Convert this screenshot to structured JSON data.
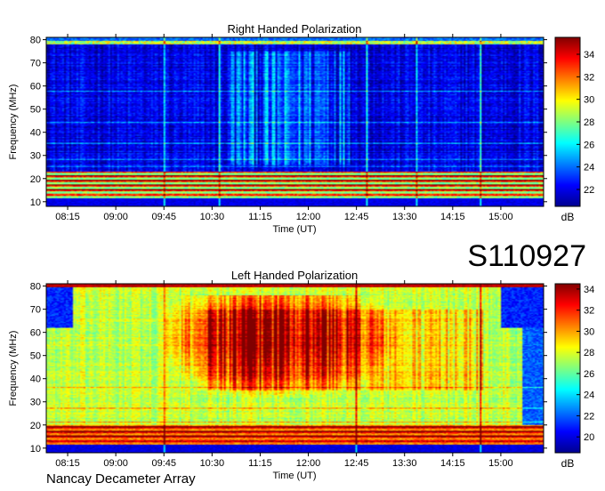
{
  "chart_data": [
    {
      "type": "heatmap",
      "title": "Right Handed Polarization",
      "xlabel": "Time (UT)",
      "ylabel": "Frequency (MHz)",
      "x_ticks": [
        "08:15",
        "09:00",
        "09:45",
        "10:30",
        "11:15",
        "12:00",
        "12:45",
        "13:30",
        "14:15",
        "15:00"
      ],
      "x_range": [
        "07:55",
        "15:40"
      ],
      "y_ticks": [
        10,
        20,
        30,
        40,
        50,
        60,
        70,
        80
      ],
      "ylim": [
        8,
        81
      ],
      "colorbar": {
        "label": "dB",
        "ticks": [
          22,
          24,
          26,
          28,
          30,
          32,
          34
        ],
        "range": [
          20.5,
          35.5
        ]
      },
      "colormap": "jet",
      "features": {
        "background_db": 22,
        "low_freq_band_mhz": [
          10,
          23
        ],
        "low_freq_band_db": 33,
        "top_band_mhz": 79,
        "top_band_db": 29,
        "horizontal_lines_mhz": [
          15,
          17,
          19,
          21,
          25,
          28,
          35,
          44,
          58
        ],
        "vertical_lines": [
          "09:45",
          "10:37",
          "12:55",
          "13:42",
          "14:42"
        ],
        "enhanced_interval": [
          "10:45",
          "12:45"
        ],
        "enhanced_db": 25
      }
    },
    {
      "type": "heatmap",
      "title": "Left Handed Polarization",
      "xlabel": "Time (UT)",
      "ylabel": "Frequency (MHz)",
      "x_ticks": [
        "08:15",
        "09:00",
        "09:45",
        "10:30",
        "11:15",
        "12:00",
        "12:45",
        "13:30",
        "14:15",
        "15:00"
      ],
      "x_range": [
        "07:55",
        "15:40"
      ],
      "y_ticks": [
        10,
        20,
        30,
        40,
        50,
        60,
        70,
        80
      ],
      "ylim": [
        8,
        81
      ],
      "colorbar": {
        "label": "dB",
        "ticks": [
          20,
          22,
          24,
          26,
          28,
          30,
          32,
          34
        ],
        "range": [
          18.5,
          34.5
        ]
      },
      "colormap": "jet",
      "features": {
        "background_db": 27.5,
        "storm_core_interval": [
          "10:45",
          "12:15"
        ],
        "storm_core_freq_mhz": [
          38,
          78
        ],
        "storm_core_db": 34,
        "storm_extent_interval": [
          "09:45",
          "15:15"
        ],
        "low_freq_band_mhz": [
          10,
          20
        ],
        "low_freq_band_db": 33,
        "quiet_corner_db": 21,
        "horizontal_lines_mhz": [
          15,
          17,
          19,
          21,
          27,
          36
        ],
        "vertical_lines": [
          "09:45",
          "12:45",
          "14:42"
        ]
      }
    }
  ],
  "labels": {
    "observation_id": "S110927",
    "instrument": "Nancay Decameter Array"
  }
}
